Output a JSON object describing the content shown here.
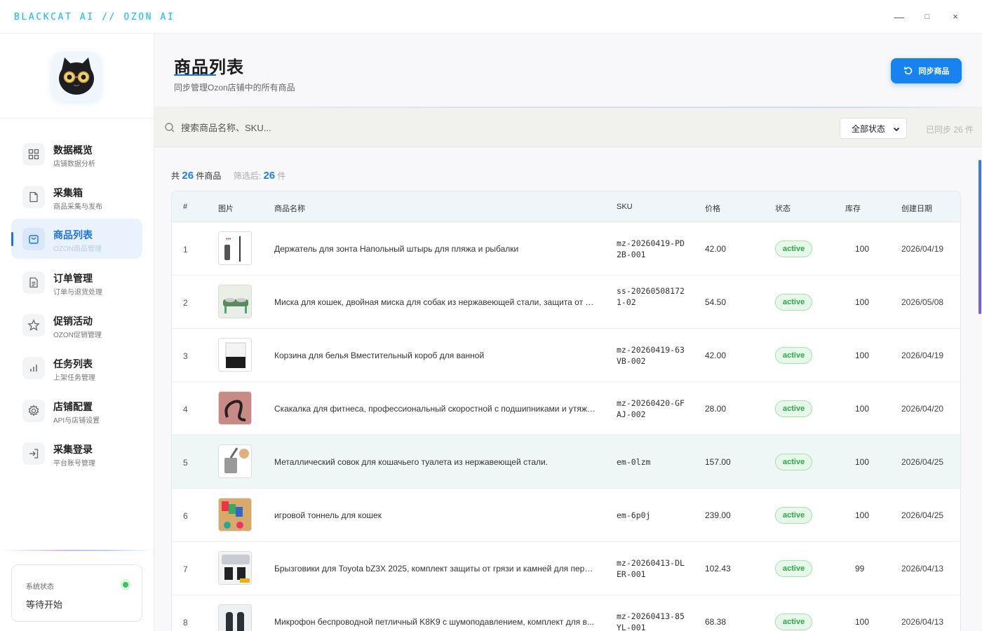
{
  "window": {
    "title": "BLACKCAT AI // OZON AI",
    "minimize_glyph": "—",
    "maximize_glyph": "□",
    "close_glyph": "×"
  },
  "sidebar": {
    "items": [
      {
        "label": "数据概览",
        "sub": "店铺数据分析",
        "icon": "grid-icon",
        "active": false
      },
      {
        "label": "采集箱",
        "sub": "商品采集与发布",
        "icon": "file-icon",
        "active": false
      },
      {
        "label": "商品列表",
        "sub": "OZON商品管理",
        "icon": "bag-icon",
        "active": true
      },
      {
        "label": "订单管理",
        "sub": "订单与退货处理",
        "icon": "document-icon",
        "active": false
      },
      {
        "label": "促销活动",
        "sub": "OZON促销管理",
        "icon": "star-icon",
        "active": false
      },
      {
        "label": "任务列表",
        "sub": "上架任务管理",
        "icon": "bar-chart-icon",
        "active": false
      },
      {
        "label": "店铺配置",
        "sub": "API与店铺设置",
        "icon": "gear-icon",
        "active": false
      },
      {
        "label": "采集登录",
        "sub": "平台账号管理",
        "icon": "login-icon",
        "active": false
      }
    ],
    "status": {
      "title": "系统状态",
      "value": "等待开始",
      "color": "#34c759"
    }
  },
  "header": {
    "title": "商品列表",
    "subtitle": "同步管理Ozon店铺中的所有商品",
    "sync_label": "同步商品"
  },
  "toolbar": {
    "search_placeholder": "搜索商品名称、SKU...",
    "status_filter": "全部状态",
    "synced_text": "已同步 26 件"
  },
  "counts": {
    "total_prefix": "共",
    "total": "26",
    "total_suffix": "件商品",
    "filtered_prefix": "筛选后:",
    "filtered": "26",
    "filtered_suffix": "件"
  },
  "table": {
    "columns": [
      "#",
      "图片",
      "商品名称",
      "SKU",
      "价格",
      "状态",
      "库存",
      "创建日期"
    ],
    "rows": [
      {
        "idx": "1",
        "name": "Держатель для зонта Напольный штырь для пляжа и рыбалки",
        "sku": "mz-20260419-PD2B-001",
        "price": "42.00",
        "status": "active",
        "stock": "100",
        "date": "2026/04/19",
        "thumb": "umbrella-holder"
      },
      {
        "idx": "2",
        "name": "Миска для кошек, двойная миска для собак из нержавеющей стали, защита от о...",
        "sku": "ss-202605081721-02",
        "price": "54.50",
        "status": "active",
        "stock": "100",
        "date": "2026/05/08",
        "thumb": "pet-bowl"
      },
      {
        "idx": "3",
        "name": "Корзина для белья Вместительный короб для ванной",
        "sku": "mz-20260419-63VB-002",
        "price": "42.00",
        "status": "active",
        "stock": "100",
        "date": "2026/04/19",
        "thumb": "laundry-basket"
      },
      {
        "idx": "4",
        "name": "Скакалка для фитнеса, профессиональный скоростной с подшипниками и утяже...",
        "sku": "mz-20260420-GFAJ-002",
        "price": "28.00",
        "status": "active",
        "stock": "100",
        "date": "2026/04/20",
        "thumb": "jump-rope"
      },
      {
        "idx": "5",
        "name": "Металлический совок для кошачьего туалета из нержавеющей стали.",
        "sku": "em-0lzm",
        "price": "157.00",
        "status": "active",
        "stock": "100",
        "date": "2026/04/25",
        "thumb": "litter-scoop"
      },
      {
        "idx": "6",
        "name": "игровой тоннель для кошек",
        "sku": "em-6p0j",
        "price": "239.00",
        "status": "active",
        "stock": "100",
        "date": "2026/04/25",
        "thumb": "cat-tunnel"
      },
      {
        "idx": "7",
        "name": "Брызговики для Toyota bZ3X 2025, комплект защиты от грязи и камней для пере...",
        "sku": "mz-20260413-DLER-001",
        "price": "102.43",
        "status": "active",
        "stock": "99",
        "date": "2026/04/13",
        "thumb": "mud-flaps"
      },
      {
        "idx": "8",
        "name": "Микрофон беспроводной петличный K8K9 с шумоподавлением, комплект для в...",
        "sku": "mz-20260413-85YL-001",
        "price": "68.38",
        "status": "active",
        "stock": "100",
        "date": "2026/04/13",
        "thumb": "microphone"
      }
    ]
  }
}
